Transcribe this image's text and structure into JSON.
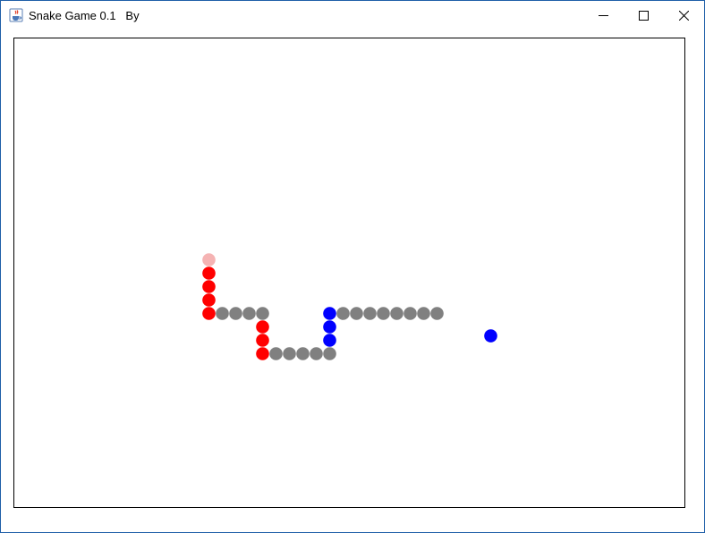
{
  "window": {
    "title": "Snake Game 0.1   By",
    "icons": {
      "app": "java-cup-icon",
      "minimize": "minimize-icon",
      "maximize": "maximize-icon",
      "close": "close-icon"
    }
  },
  "game": {
    "colors": {
      "head_red_snake": "#f5b3b3",
      "body_red": "#ff0000",
      "body_grey": "#808080",
      "body_blue": "#0000ff",
      "food": "#0000ff"
    },
    "red_snake": {
      "head": {
        "col": 14,
        "row": 16
      },
      "segments": [
        {
          "col": 14,
          "row": 17,
          "color": "#ff0000"
        },
        {
          "col": 14,
          "row": 18,
          "color": "#ff0000"
        },
        {
          "col": 14,
          "row": 19,
          "color": "#ff0000"
        },
        {
          "col": 14,
          "row": 20,
          "color": "#ff0000"
        },
        {
          "col": 15,
          "row": 20,
          "color": "#808080"
        },
        {
          "col": 16,
          "row": 20,
          "color": "#808080"
        },
        {
          "col": 17,
          "row": 20,
          "color": "#808080"
        },
        {
          "col": 18,
          "row": 20,
          "color": "#808080"
        },
        {
          "col": 18,
          "row": 21,
          "color": "#ff0000"
        },
        {
          "col": 18,
          "row": 22,
          "color": "#ff0000"
        },
        {
          "col": 18,
          "row": 23,
          "color": "#ff0000"
        },
        {
          "col": 19,
          "row": 23,
          "color": "#808080"
        },
        {
          "col": 20,
          "row": 23,
          "color": "#808080"
        },
        {
          "col": 21,
          "row": 23,
          "color": "#808080"
        },
        {
          "col": 22,
          "row": 23,
          "color": "#808080"
        },
        {
          "col": 23,
          "row": 23,
          "color": "#808080"
        }
      ]
    },
    "blue_snake": {
      "segments": [
        {
          "col": 23,
          "row": 22,
          "color": "#0000ff"
        },
        {
          "col": 23,
          "row": 21,
          "color": "#0000ff"
        },
        {
          "col": 23,
          "row": 20,
          "color": "#0000ff"
        },
        {
          "col": 24,
          "row": 20,
          "color": "#808080"
        },
        {
          "col": 25,
          "row": 20,
          "color": "#808080"
        },
        {
          "col": 26,
          "row": 20,
          "color": "#808080"
        },
        {
          "col": 27,
          "row": 20,
          "color": "#808080"
        },
        {
          "col": 28,
          "row": 20,
          "color": "#808080"
        },
        {
          "col": 29,
          "row": 20,
          "color": "#808080"
        },
        {
          "col": 30,
          "row": 20,
          "color": "#808080"
        },
        {
          "col": 31,
          "row": 20,
          "color": "#808080"
        }
      ]
    },
    "food": {
      "col": 35,
      "row": 21.67
    }
  }
}
